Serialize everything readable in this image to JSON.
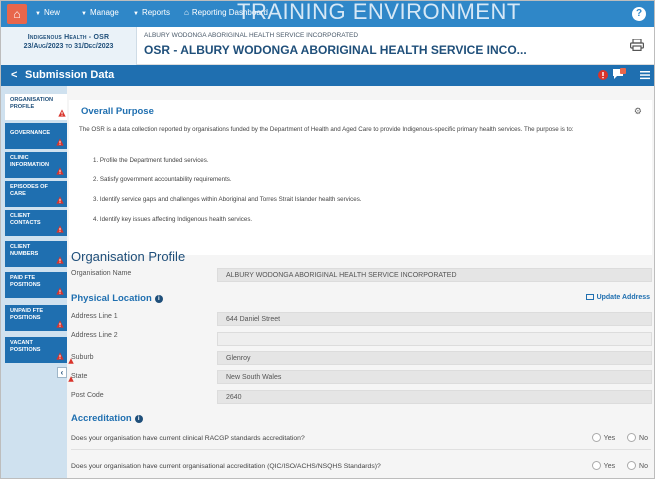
{
  "topnav": {
    "new_label": "New",
    "manage_label": "Manage",
    "reports_label": "Reports",
    "dashboard_label": "Reporting Dashboard",
    "environment_banner": "TRAINING ENVIRONMENT"
  },
  "header": {
    "collection": "Indigenous Health - OSR",
    "period": "23/Aug/2023 to 31/Dec/2023",
    "org_name_small": "ALBURY WODONGA ABORIGINAL HEALTH SERVICE INCORPORATED",
    "org_name_large": "OSR - ALBURY WODONGA ABORIGINAL HEALTH SERVICE INCO..."
  },
  "subbar": {
    "back_glyph": "<",
    "title": "Submission Data",
    "comment_count": "1"
  },
  "sidebar": {
    "items": [
      {
        "line1": "ORGANISATION",
        "line2": "PROFILE"
      },
      {
        "line1": "GOVERNANCE",
        "line2": ""
      },
      {
        "line1": "CLINIC",
        "line2": "INFORMATION"
      },
      {
        "line1": "EPISODES OF",
        "line2": "CARE"
      },
      {
        "line1": "CLIENT",
        "line2": "CONTACTS"
      },
      {
        "line1": "CLIENT",
        "line2": "NUMBERS"
      },
      {
        "line1": "PAID FTE",
        "line2": "POSITIONS"
      },
      {
        "line1": "UNPAID FTE",
        "line2": "POSITIONS"
      },
      {
        "line1": "VACANT",
        "line2": "POSITIONS"
      }
    ]
  },
  "purpose": {
    "title": "Overall Purpose",
    "close_glyph": "⚙",
    "intro": "The OSR is a data collection reported by organisations funded by the Department of Health and Aged Care to provide Indigenous-specific primary health services. The purpose is to:",
    "items": [
      "1. Profile the Department funded services.",
      "2. Satisfy government accountability requirements.",
      "3. Identify service gaps and challenges within Aboriginal and Torres Strait Islander health services.",
      "4. Identify key issues affecting Indigenous health services."
    ]
  },
  "profile": {
    "title": "Organisation Profile",
    "org_name_label": "Organisation Name",
    "org_name_value": "ALBURY WODONGA ABORIGINAL HEALTH SERVICE INCORPORATED"
  },
  "location": {
    "title": "Physical Location",
    "update_label": "Update Address",
    "fields": [
      {
        "label": "Address Line 1",
        "value": "644 Daniel Street"
      },
      {
        "label": "Address Line 2",
        "value": ""
      },
      {
        "label": "Suburb",
        "value": "Glenroy"
      },
      {
        "label": "State",
        "value": "New South Wales"
      },
      {
        "label": "Post Code",
        "value": "2640"
      }
    ]
  },
  "accreditation": {
    "title": "Accreditation",
    "yes_label": "Yes",
    "no_label": "No",
    "questions": [
      "Does your organisation have current clinical RACGP standards accreditation?",
      "Does your organisation have current organisational accreditation (QIC/ISO/ACHS/NSQHS Standards)?"
    ]
  },
  "colors": {
    "nav_blue": "#2f87c8",
    "bar_blue": "#1f6fb0",
    "warning_red": "#d9342b",
    "comment_orange": "#e8664b"
  }
}
